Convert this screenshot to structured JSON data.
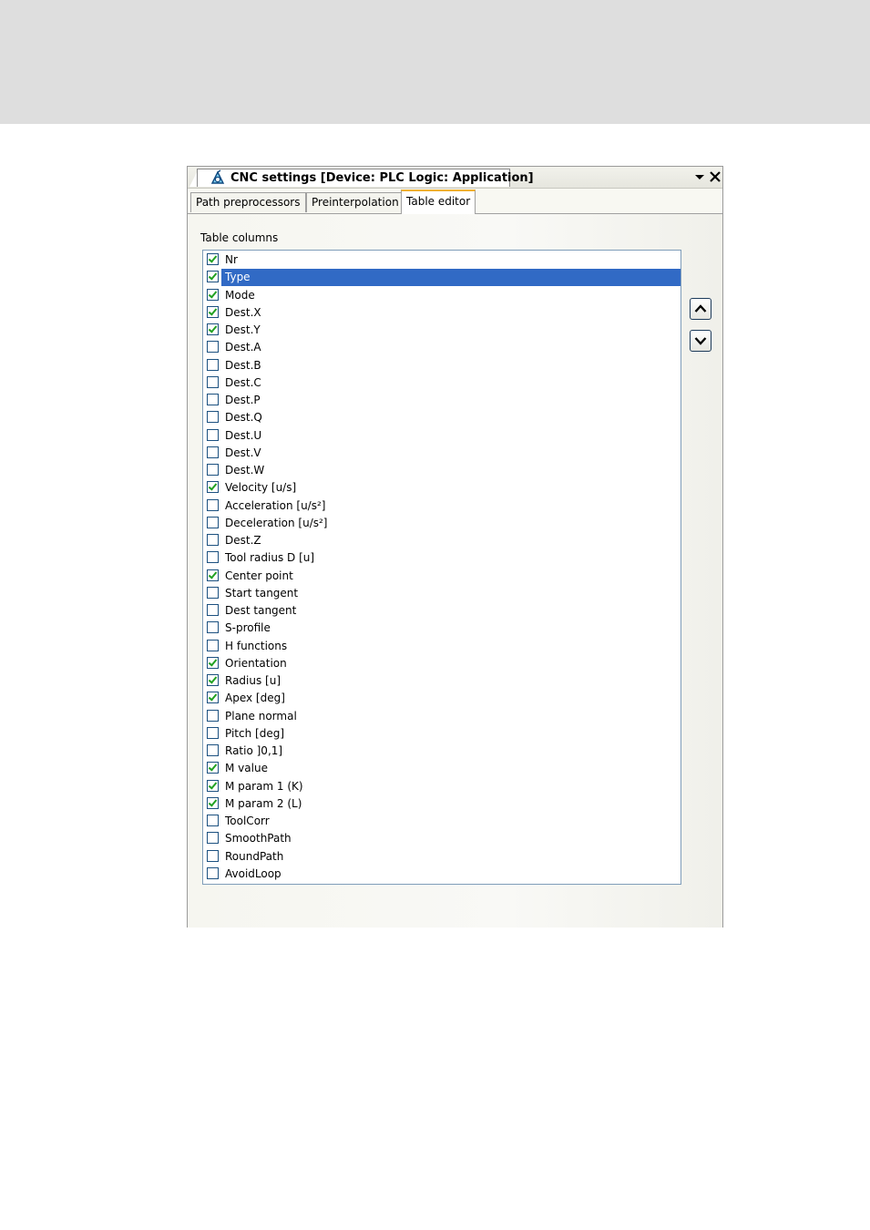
{
  "window": {
    "title": "CNC settings [Device: PLC Logic: Application]",
    "dropdown_icon": "triangle-down-icon",
    "close_icon": "close-icon",
    "app_icon": "cnc-app-icon"
  },
  "tabs": [
    {
      "label": "Path preprocessors",
      "active": false
    },
    {
      "label": "Preinterpolation",
      "active": false
    },
    {
      "label": "Table editor",
      "active": true
    }
  ],
  "group_label": "Table columns",
  "columns": [
    {
      "label": "Nr",
      "checked": true
    },
    {
      "label": "Type",
      "checked": true,
      "selected": true
    },
    {
      "label": "Mode",
      "checked": true
    },
    {
      "label": "Dest.X",
      "checked": true
    },
    {
      "label": "Dest.Y",
      "checked": true
    },
    {
      "label": "Dest.A",
      "checked": false
    },
    {
      "label": "Dest.B",
      "checked": false
    },
    {
      "label": "Dest.C",
      "checked": false
    },
    {
      "label": "Dest.P",
      "checked": false
    },
    {
      "label": "Dest.Q",
      "checked": false
    },
    {
      "label": "Dest.U",
      "checked": false
    },
    {
      "label": "Dest.V",
      "checked": false
    },
    {
      "label": "Dest.W",
      "checked": false
    },
    {
      "label": "Velocity [u/s]",
      "checked": true
    },
    {
      "label": "Acceleration [u/s²]",
      "checked": false
    },
    {
      "label": "Deceleration [u/s²]",
      "checked": false
    },
    {
      "label": "Dest.Z",
      "checked": false
    },
    {
      "label": "Tool radius D [u]",
      "checked": false
    },
    {
      "label": "Center point",
      "checked": true
    },
    {
      "label": "Start tangent",
      "checked": false
    },
    {
      "label": "Dest tangent",
      "checked": false
    },
    {
      "label": "S-profile",
      "checked": false
    },
    {
      "label": "H functions",
      "checked": false
    },
    {
      "label": "Orientation",
      "checked": true
    },
    {
      "label": "Radius [u]",
      "checked": true
    },
    {
      "label": "Apex [deg]",
      "checked": true
    },
    {
      "label": "Plane normal",
      "checked": false
    },
    {
      "label": "Pitch [deg]",
      "checked": false
    },
    {
      "label": "Ratio ]0,1]",
      "checked": false
    },
    {
      "label": "M value",
      "checked": true
    },
    {
      "label": "M param 1 (K)",
      "checked": true
    },
    {
      "label": "M param 2 (L)",
      "checked": true
    },
    {
      "label": "ToolCorr",
      "checked": false
    },
    {
      "label": "SmoothPath",
      "checked": false
    },
    {
      "label": "RoundPath",
      "checked": false
    },
    {
      "label": "AvoidLoop",
      "checked": false
    }
  ],
  "buttons": {
    "move_up_icon": "chevron-up-icon",
    "move_down_icon": "chevron-down-icon"
  },
  "colors": {
    "selection": "#316ac5",
    "checkmark": "#21a121",
    "active_tab_accent": "#f0b030"
  }
}
